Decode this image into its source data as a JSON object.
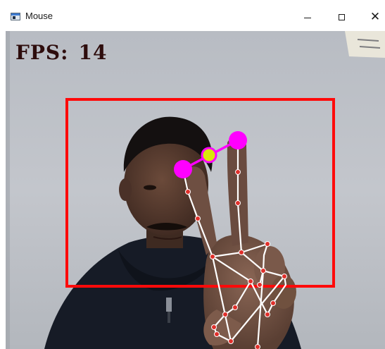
{
  "window": {
    "title": "Mouse",
    "controls": {
      "minimize_icon": "minimize-icon",
      "maximize_icon": "maximize-icon",
      "close_icon": "close-icon",
      "close_glyph": "✕"
    }
  },
  "overlay": {
    "fps_label": "FPS:",
    "fps_value": "14"
  },
  "colors": {
    "frame_box": "#ff0a0a",
    "fingertip": "#ff00ff",
    "midpoint": "#d9e60a",
    "landmark": "#e0302b",
    "skeleton": "#ffffff",
    "fps_text": "#2e0d0d"
  }
}
